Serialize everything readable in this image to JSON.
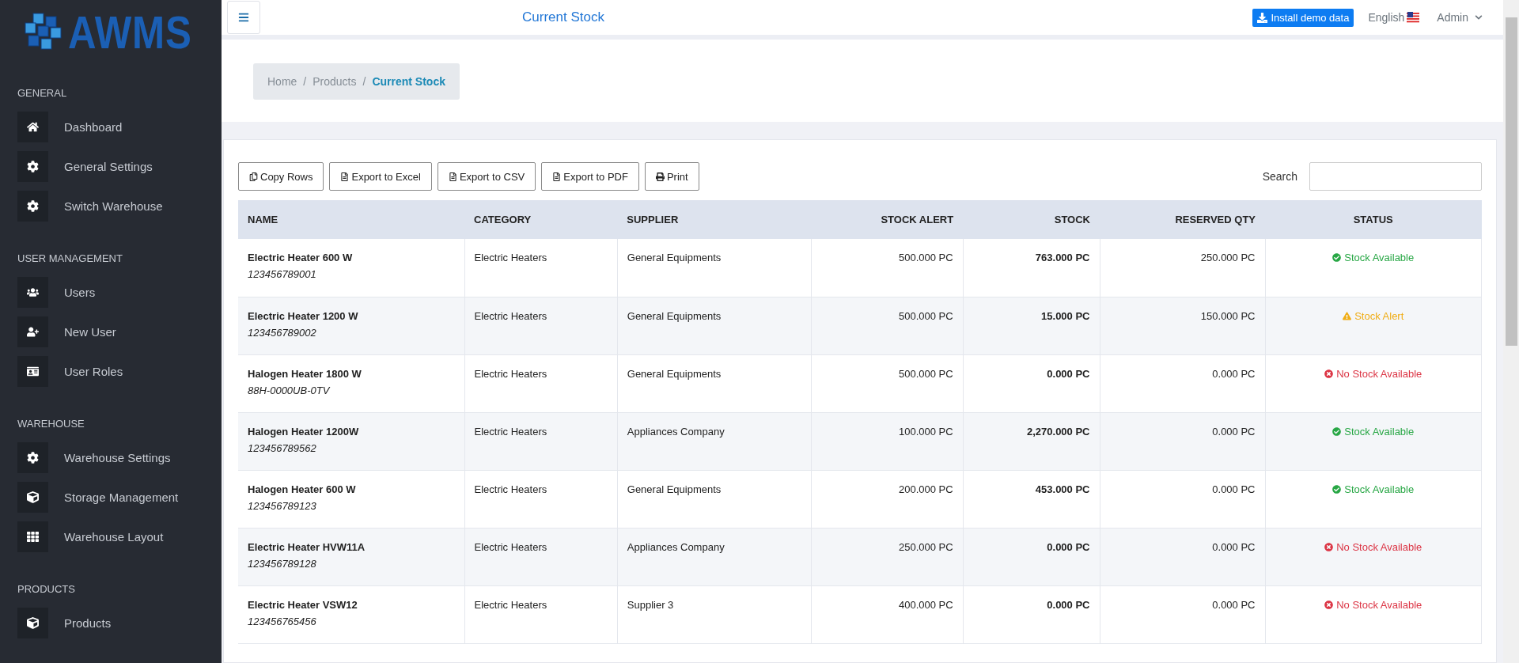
{
  "logo": {
    "text": "AWMS"
  },
  "sidebar": {
    "sections": [
      {
        "title": "GENERAL",
        "items": [
          {
            "label": "Dashboard"
          },
          {
            "label": "General Settings"
          },
          {
            "label": "Switch Warehouse"
          }
        ]
      },
      {
        "title": "USER MANAGEMENT",
        "items": [
          {
            "label": "Users"
          },
          {
            "label": "New User"
          },
          {
            "label": "User Roles"
          }
        ]
      },
      {
        "title": "WAREHOUSE",
        "items": [
          {
            "label": "Warehouse Settings"
          },
          {
            "label": "Storage Management"
          },
          {
            "label": "Warehouse Layout"
          }
        ]
      },
      {
        "title": "PRODUCTS",
        "items": [
          {
            "label": "Products"
          }
        ]
      }
    ]
  },
  "topbar": {
    "title": "Current Stock",
    "install_button": "Install demo data",
    "language": "English",
    "user": "Admin"
  },
  "breadcrumb": {
    "separator": "/",
    "items": [
      {
        "label": "Home",
        "selected": false
      },
      {
        "label": "Products",
        "selected": false
      },
      {
        "label": "Current Stock",
        "selected": true
      }
    ]
  },
  "toolbar": {
    "buttons": [
      {
        "label": "Copy Rows"
      },
      {
        "label": "Export to Excel"
      },
      {
        "label": "Export to CSV"
      },
      {
        "label": "Export to PDF"
      },
      {
        "label": "Print"
      }
    ],
    "search_label": "Search"
  },
  "table": {
    "columns": [
      "NAME",
      "CATEGORY",
      "SUPPLIER",
      "STOCK ALERT",
      "STOCK",
      "RESERVED QTY",
      "STATUS"
    ],
    "rows": [
      {
        "name": "Electric Heater 600 W",
        "sku": "123456789001",
        "category": "Electric Heaters",
        "supplier": "General Equipments",
        "stock_alert": "500.000 PC",
        "stock": "763.000 PC",
        "reserved": "250.000 PC",
        "status": {
          "kind": "available",
          "label": "Stock Available"
        }
      },
      {
        "name": "Electric Heater 1200 W",
        "sku": "123456789002",
        "category": "Electric Heaters",
        "supplier": "General Equipments",
        "stock_alert": "500.000 PC",
        "stock": "15.000 PC",
        "reserved": "150.000 PC",
        "status": {
          "kind": "alert",
          "label": "Stock Alert"
        }
      },
      {
        "name": "Halogen Heater 1800 W",
        "sku": "88H-0000UB-0TV",
        "category": "Electric Heaters",
        "supplier": "General Equipments",
        "stock_alert": "500.000 PC",
        "stock": "0.000 PC",
        "reserved": "0.000 PC",
        "status": {
          "kind": "none",
          "label": "No Stock Available"
        }
      },
      {
        "name": "Halogen Heater 1200W",
        "sku": "123456789562",
        "category": "Electric Heaters",
        "supplier": "Appliances Company",
        "stock_alert": "100.000 PC",
        "stock": "2,270.000 PC",
        "reserved": "0.000 PC",
        "status": {
          "kind": "available",
          "label": "Stock Available"
        }
      },
      {
        "name": "Halogen Heater 600 W",
        "sku": "123456789123",
        "category": "Electric Heaters",
        "supplier": "General Equipments",
        "stock_alert": "200.000 PC",
        "stock": "453.000 PC",
        "reserved": "0.000 PC",
        "status": {
          "kind": "available",
          "label": "Stock Available"
        }
      },
      {
        "name": "Electric Heater HVW11A",
        "sku": "123456789128",
        "category": "Electric Heaters",
        "supplier": "Appliances Company",
        "stock_alert": "250.000 PC",
        "stock": "0.000 PC",
        "reserved": "0.000 PC",
        "status": {
          "kind": "none",
          "label": "No Stock Available"
        }
      },
      {
        "name": "Electric Heater VSW12",
        "sku": "123456765456",
        "category": "Electric Heaters",
        "supplier": "Supplier 3",
        "stock_alert": "400.000 PC",
        "stock": "0.000 PC",
        "reserved": "0.000 PC",
        "status": {
          "kind": "none",
          "label": "No Stock Available"
        }
      }
    ]
  }
}
